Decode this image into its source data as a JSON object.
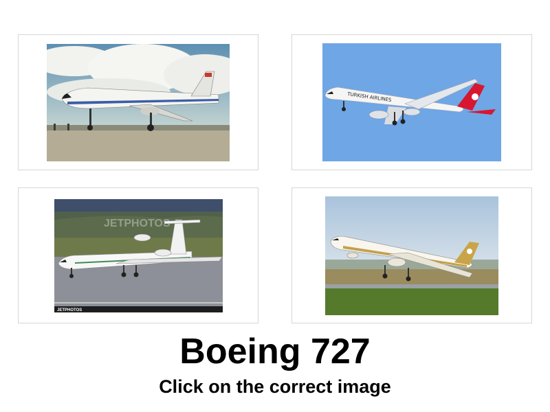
{
  "captcha": {
    "title": "Boeing 727",
    "instruction": "Click on the correct image"
  },
  "images": [
    {
      "id": "option-1",
      "depicts": "vintage-airliner-on-tarmac-under-cloudy-sky",
      "aircraft_text": ""
    },
    {
      "id": "option-2",
      "depicts": "twin-engine-widebody-in-flight-blue-sky",
      "aircraft_text": "TURKISH AIRLINES"
    },
    {
      "id": "option-3",
      "depicts": "white-trijet-taxiing-on-runway",
      "watermark": "JETPHOTOS",
      "footer_logo": "JETPHOTOS"
    },
    {
      "id": "option-4",
      "depicts": "gold-livery-widebody-taking-off",
      "aircraft_text": ""
    }
  ],
  "colors": {
    "card_border": "#d6d6d6",
    "text": "#000000",
    "background": "#ffffff"
  }
}
